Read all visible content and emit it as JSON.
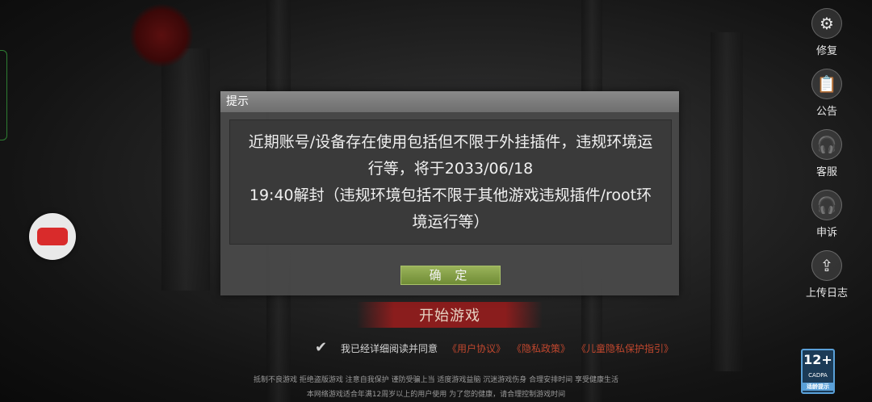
{
  "side_menu": [
    {
      "label": "修复",
      "icon": "gear-icon"
    },
    {
      "label": "公告",
      "icon": "announcement-icon"
    },
    {
      "label": "客服",
      "icon": "headset-icon"
    },
    {
      "label": "申诉",
      "icon": "appeal-headset-icon"
    },
    {
      "label": "上传日志",
      "icon": "upload-icon"
    }
  ],
  "start_button": {
    "label": "开始游戏"
  },
  "agreement": {
    "text": "我已经详细阅读并同意",
    "links": [
      "《用户协议》",
      "《隐私政策》",
      "《儿童隐私保护指引》"
    ]
  },
  "footer": {
    "line1": "抵制不良游戏 拒绝盗版游戏 注意自我保护 谨防受骗上当 适度游戏益脑 沉迷游戏伤身 合理安排时间 享受健康生活",
    "line2": "本网络游戏适合年满12周岁以上的用户使用   为了您的健康，请合理控制游戏时间"
  },
  "age_badge": {
    "rating": "12+",
    "org": "CADPA",
    "tip": "适龄提示"
  },
  "dialog": {
    "title": "提示",
    "lines": [
      "近期账号/设备存在使用包括但不限于外挂插件，违规环境运",
      "行等，将于2033/06/18",
      "19:40解封（违规环境包括不限于其他游戏违规插件/root环",
      "境运行等）"
    ],
    "confirm_label": "确 定"
  }
}
